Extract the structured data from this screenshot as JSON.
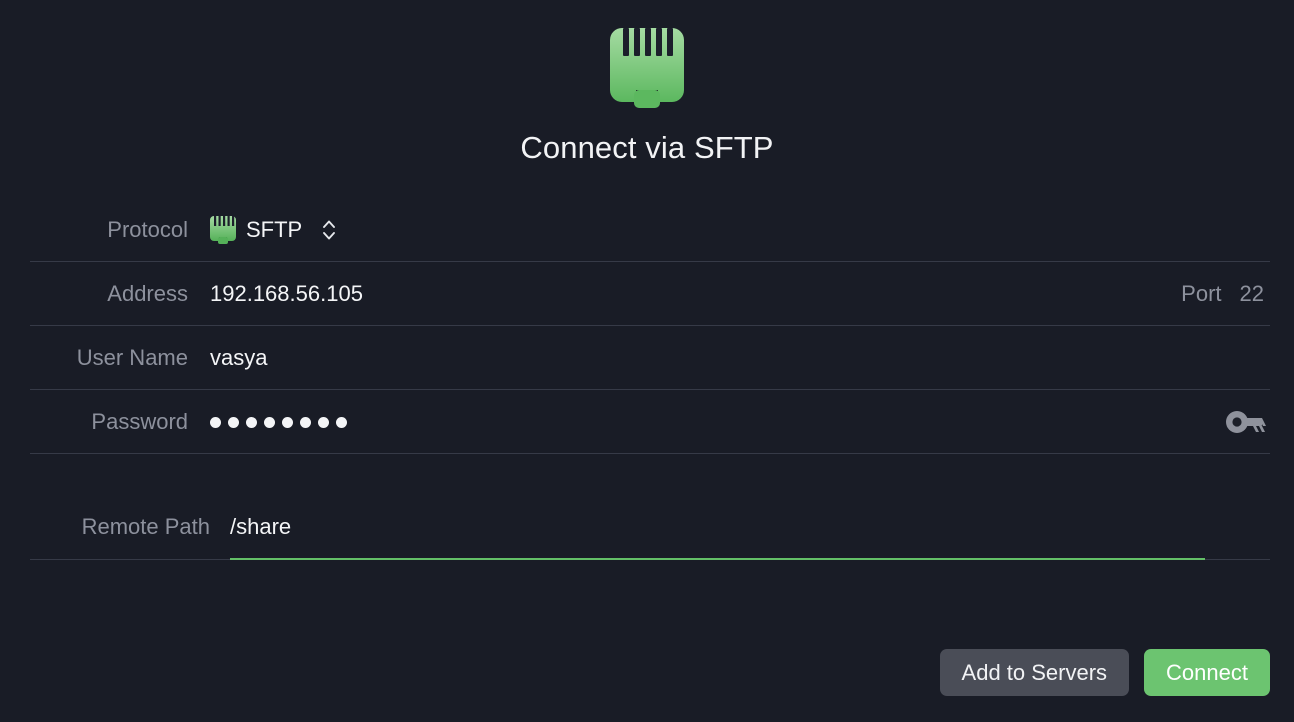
{
  "dialog": {
    "title": "Connect via SFTP",
    "icon": "ethernet-port-icon"
  },
  "form": {
    "protocol": {
      "label": "Protocol",
      "value": "SFTP",
      "icon": "ethernet-port-icon",
      "stepper_icon": "chevron-up-down-icon"
    },
    "address": {
      "label": "Address",
      "value": "192.168.56.105"
    },
    "port": {
      "label": "Port",
      "value": "22"
    },
    "user_name": {
      "label": "User Name",
      "value": "vasya"
    },
    "password": {
      "label": "Password",
      "value": "••••••••",
      "dot_count": 8,
      "key_icon": "key-icon"
    },
    "remote_path": {
      "label": "Remote Path",
      "value": "/share",
      "focused": true
    }
  },
  "footer": {
    "add_to_servers_label": "Add to Servers",
    "connect_label": "Connect"
  },
  "colors": {
    "background": "#191c26",
    "accent_green": "#6cc470",
    "focus_underline": "#63bf67",
    "divider": "#363a47",
    "label_text": "#8d919d",
    "value_text": "#f4f5f7",
    "secondary_button": "#4a4d57"
  }
}
